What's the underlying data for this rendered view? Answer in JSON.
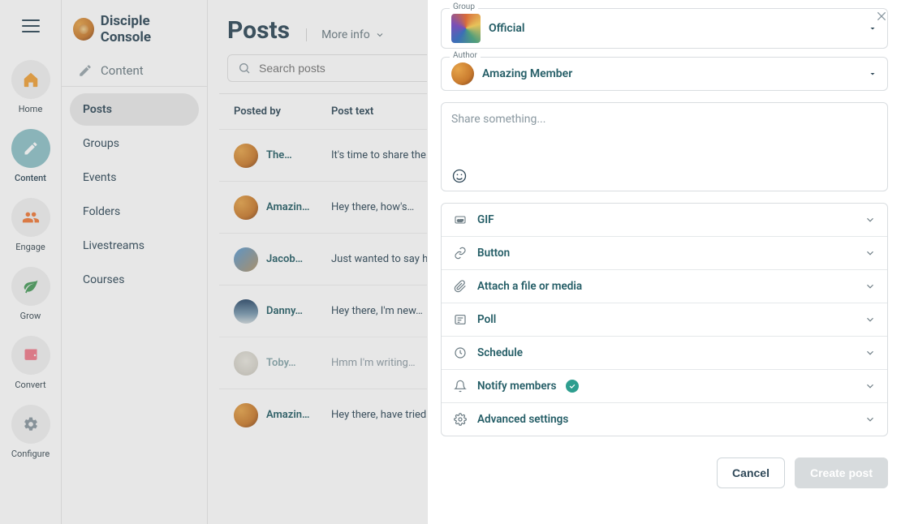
{
  "brand": {
    "title": "Disciple Console"
  },
  "rail": {
    "items": [
      {
        "label": "Home"
      },
      {
        "label": "Content",
        "active": true
      },
      {
        "label": "Engage"
      },
      {
        "label": "Grow"
      },
      {
        "label": "Convert"
      },
      {
        "label": "Configure"
      }
    ]
  },
  "subnav": {
    "header": "Content",
    "items": [
      {
        "label": "Posts",
        "active": true
      },
      {
        "label": "Groups"
      },
      {
        "label": "Events"
      },
      {
        "label": "Folders"
      },
      {
        "label": "Livestreams"
      },
      {
        "label": "Courses"
      }
    ]
  },
  "main": {
    "title": "Posts",
    "more_info": "More info",
    "search_placeholder": "Search posts",
    "columns": {
      "posted_by": "Posted by",
      "post_text": "Post text"
    },
    "rows": [
      {
        "name": "The…",
        "text": "It's time to share the…",
        "avatar": "std"
      },
      {
        "name": "Amazin…",
        "text": "Hey there, how's…",
        "avatar": "std"
      },
      {
        "name": "Jacob…",
        "text": "Just wanted to say hell…",
        "avatar": "photo1"
      },
      {
        "name": "Danny…",
        "text": "Hey there, I'm new…",
        "avatar": "photo2"
      },
      {
        "name": "Toby…",
        "text": "Hmm I'm writing…",
        "avatar": "photo3",
        "dim": true
      },
      {
        "name": "Amazin…",
        "text": "Hey there, have tried…",
        "avatar": "std"
      }
    ]
  },
  "panel": {
    "group_label": "Group",
    "group_value": "Official",
    "author_label": "Author",
    "author_value": "Amazing Member",
    "composer_placeholder": "Share something...",
    "accordion": [
      {
        "label": "GIF",
        "icon": "gif"
      },
      {
        "label": "Button",
        "icon": "link"
      },
      {
        "label": "Attach a file or media",
        "icon": "attach"
      },
      {
        "label": "Poll",
        "icon": "poll"
      },
      {
        "label": "Schedule",
        "icon": "clock"
      },
      {
        "label": "Notify members",
        "icon": "bell",
        "check": true
      },
      {
        "label": "Advanced settings",
        "icon": "gear"
      }
    ],
    "cancel_label": "Cancel",
    "submit_label": "Create post"
  }
}
